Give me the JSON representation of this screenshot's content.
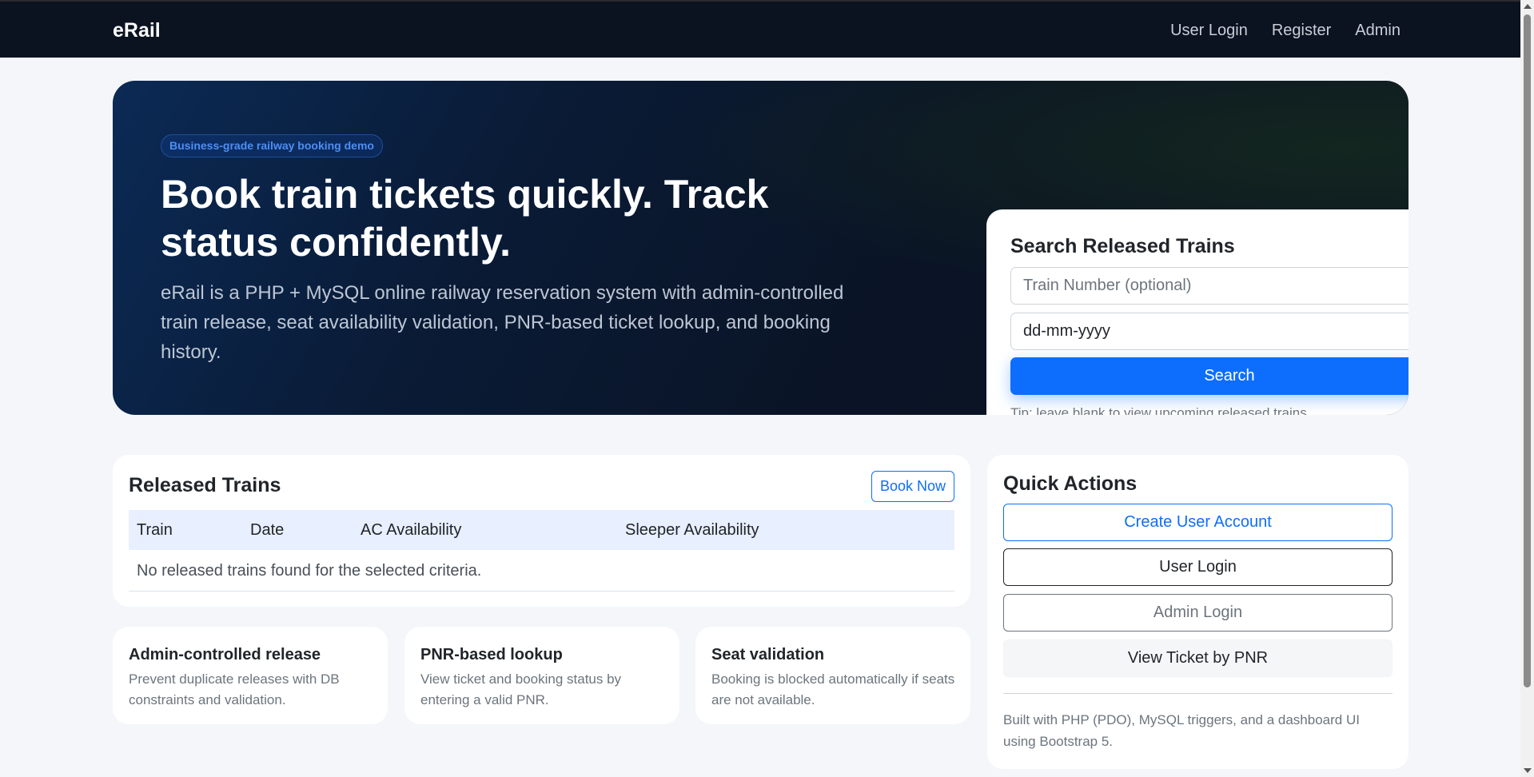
{
  "navbar": {
    "brand": "eRail",
    "links": [
      "User Login",
      "Register",
      "Admin"
    ]
  },
  "hero": {
    "pill": "Business-grade railway booking demo",
    "title": "Book train tickets quickly. Track status confidently.",
    "description": "eRail is a PHP + MySQL online railway reservation system with admin-controlled train release, seat availability validation, PNR-based ticket lookup, and booking history."
  },
  "search": {
    "title": "Search Released Trains",
    "train_placeholder": "Train Number (optional)",
    "date_placeholder": "dd-mm-yyyy",
    "button": "Search",
    "tip": "Tip: leave blank to view upcoming released trains."
  },
  "released": {
    "title": "Released Trains",
    "book_button": "Book Now",
    "columns": [
      "Train",
      "Date",
      "AC Availability",
      "Sleeper Availability"
    ],
    "empty_message": "No released trains found for the selected criteria."
  },
  "features": [
    {
      "title": "Admin-controlled release",
      "desc": "Prevent duplicate releases with DB constraints and validation."
    },
    {
      "title": "PNR-based lookup",
      "desc": "View ticket and booking status by entering a valid PNR."
    },
    {
      "title": "Seat validation",
      "desc": "Booking is blocked automatically if seats are not available."
    }
  ],
  "quick": {
    "title": "Quick Actions",
    "buttons": [
      "Create User Account",
      "User Login",
      "Admin Login",
      "View Ticket by PNR"
    ],
    "note": "Built with PHP (PDO), MySQL triggers, and a dashboard UI using Bootstrap 5."
  },
  "colors": {
    "primary": "#0d6efd",
    "navbar": "#0b1220",
    "hero_dark": "#0a1426"
  }
}
